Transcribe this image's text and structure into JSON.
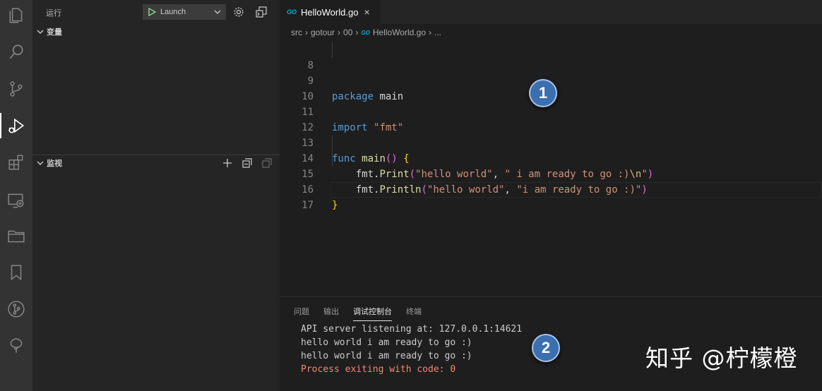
{
  "activity_bar": {
    "items": [
      {
        "name": "explorer-icon"
      },
      {
        "name": "search-icon"
      },
      {
        "name": "source-control-icon"
      },
      {
        "name": "run-debug-icon",
        "active": true
      },
      {
        "name": "extensions-icon"
      },
      {
        "name": "remote-explorer-icon"
      },
      {
        "name": "folder-icon"
      },
      {
        "name": "bookmark-icon"
      },
      {
        "name": "git-graph-icon"
      },
      {
        "name": "tree-icon"
      }
    ]
  },
  "sidebar": {
    "title": "运行",
    "launch_config": "Launch",
    "sections": {
      "variables": "变量",
      "watch": "监视"
    }
  },
  "editor": {
    "tab": {
      "badge": "GO",
      "label": "HelloWorld.go",
      "close": "×"
    },
    "breadcrumb": [
      "src",
      "gotour",
      "00",
      "HelloWorld.go",
      "..."
    ],
    "line_numbers": [
      "8",
      "9",
      "10",
      "11",
      "12",
      "13",
      "14",
      "15",
      "16",
      "17"
    ],
    "code": {
      "l9_kw": "package",
      "l9_rest": " main",
      "l11_kw": "import",
      "l11_str": "\"fmt\"",
      "l13_kw": "func",
      "l13_fn": "main",
      "l13_paren": "()",
      "l13_brace": "{",
      "l14_pkg": "fmt.",
      "l14_fn": "Print",
      "l14_open": "(",
      "l14_s1": "\"hello world\"",
      "l14_comma": ", ",
      "l14_s2a": "\" i am ready to go :)",
      "l14_esc": "\\n",
      "l14_s2b": "\"",
      "l14_close": ")",
      "l15_pkg": "fmt.",
      "l15_fn": "Println",
      "l15_open": "(",
      "l15_s1": "\"hello world\"",
      "l15_comma": ", ",
      "l15_s2": "\"i am ready to go :)\"",
      "l15_close": ")",
      "l16_brace": "}"
    },
    "annotation": "1"
  },
  "panel": {
    "tabs": [
      "问题",
      "输出",
      "调试控制台",
      "终端"
    ],
    "active_tab": "调试控制台",
    "output": [
      "API server listening at: 127.0.0.1:14621",
      "hello world i am ready to go :)",
      "hello world i am ready to go :)",
      "Process exiting with code: 0"
    ],
    "annotation": "2",
    "watermark": "知乎 @柠檬橙"
  },
  "colors": {
    "activity_bg": "#333333",
    "sidebar_bg": "#252526",
    "editor_bg": "#1e1e1e",
    "keyword": "#569cd6",
    "string": "#ce9178",
    "function": "#dcdcaa",
    "error_text": "#f48771",
    "go_brand": "#00add8",
    "launch_play": "#89d185"
  }
}
